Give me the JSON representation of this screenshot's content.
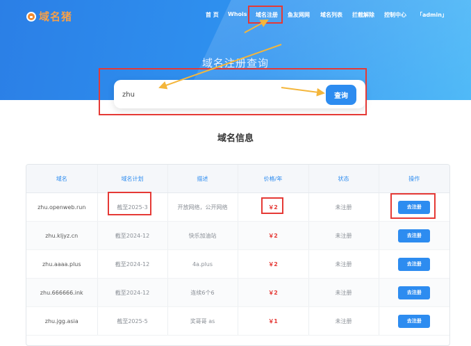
{
  "header": {
    "logo_text": "域名猪",
    "nav": [
      {
        "label": "首 页"
      },
      {
        "label": "Whois"
      },
      {
        "label": "域名注册"
      },
      {
        "label": "鱼友网网"
      },
      {
        "label": "域名列表"
      },
      {
        "label": "拦截解除"
      },
      {
        "label": "控制中心"
      },
      {
        "label": "「admin」"
      }
    ]
  },
  "hero": {
    "title": "域名注册查询",
    "search_value": "zhu",
    "search_button": "查询"
  },
  "section_title": "域名信息",
  "table": {
    "headers": [
      "域名",
      "域名计划",
      "描述",
      "价格/年",
      "状态",
      "操作"
    ],
    "rows": [
      {
        "domain": "zhu.openweb.run",
        "plan": "截至2025-3",
        "desc": "开放网络，公开网络",
        "price": "￥2",
        "status": "未注册",
        "action": "去注册"
      },
      {
        "domain": "zhu.kljyz.cn",
        "plan": "截至2024-12",
        "desc": "快乐加油站",
        "price": "￥2",
        "status": "未注册",
        "action": "去注册"
      },
      {
        "domain": "zhu.aaaa.plus",
        "plan": "截至2024-12",
        "desc": "4a.plus",
        "price": "￥2",
        "status": "未注册",
        "action": "去注册"
      },
      {
        "domain": "zhu.666666.ink",
        "plan": "截至2024-12",
        "desc": "连续6个6",
        "price": "￥2",
        "status": "未注册",
        "action": "去注册"
      },
      {
        "domain": "zhu.jgg.asia",
        "plan": "截至2025-5",
        "desc": "奖哥哥 as",
        "price": "￥1",
        "status": "未注册",
        "action": "去注册"
      }
    ]
  },
  "colors": {
    "accent": "#2d8cf0",
    "price": "#e53935",
    "highlight": "#e53935",
    "arrow": "#f4b63b"
  }
}
